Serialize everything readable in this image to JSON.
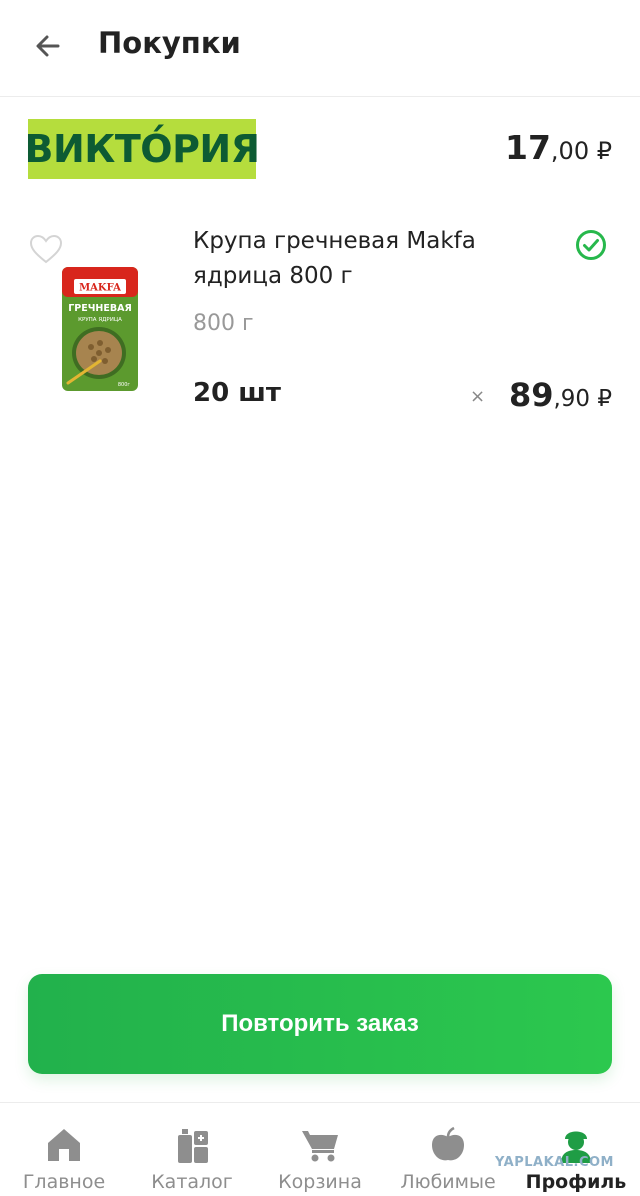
{
  "header": {
    "title": "Покупки"
  },
  "store": {
    "logo_text": "ВИКТО́РИЯ",
    "total_int": "17",
    "total_dec": ",00 ₽"
  },
  "item": {
    "name": "Крупа гречневая Makfa ядрица 800 г",
    "weight": "800 г",
    "quantity": "20 шт",
    "times": "×",
    "price_int": "89",
    "price_dec": ",90 ₽",
    "package_brand": "MAKFA",
    "package_line1": "ГРЕЧНЕВАЯ",
    "package_line2": "КРУПА ЯДРИЦА",
    "package_weight": "800г"
  },
  "actions": {
    "repeat_label": "Повторить заказ"
  },
  "tabs": [
    {
      "label": "Главное",
      "icon": "home-icon"
    },
    {
      "label": "Каталог",
      "icon": "catalog-icon"
    },
    {
      "label": "Корзина",
      "icon": "cart-icon"
    },
    {
      "label": "Любимые",
      "icon": "apple-icon"
    },
    {
      "label": "Профиль",
      "icon": "profile-icon"
    }
  ],
  "watermark": "YAPLAKAL.COM",
  "colors": {
    "accent_green": "#27b84c",
    "logo_bg": "#b5dd3d",
    "logo_text": "#0d5b33",
    "profile_active": "#1f9d45"
  }
}
